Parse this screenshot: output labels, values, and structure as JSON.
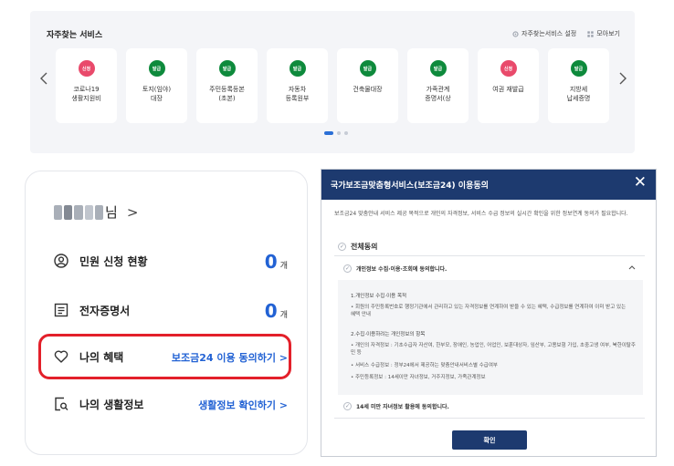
{
  "services": {
    "title": "자주찾는 서비스",
    "settings_label": "자주찾는서비스 설정",
    "view_all_label": "모아보기",
    "items": [
      {
        "badge": "신청",
        "badge_color": "#e94a6b",
        "name": "코로나19\n생활지원비"
      },
      {
        "badge": "발급",
        "badge_color": "#0e8a3c",
        "name": "토지(임야)\n대장"
      },
      {
        "badge": "발급",
        "badge_color": "#0e8a3c",
        "name": "주민등록등본\n(초본)"
      },
      {
        "badge": "발급",
        "badge_color": "#0e8a3c",
        "name": "자동차\n등록원부"
      },
      {
        "badge": "발급",
        "badge_color": "#0e8a3c",
        "name": "건축물대장"
      },
      {
        "badge": "발급",
        "badge_color": "#0e8a3c",
        "name": "가족관계\n증명서(상"
      },
      {
        "badge": "신청",
        "badge_color": "#e94a6b",
        "name": "여권 재발급"
      },
      {
        "badge": "발급",
        "badge_color": "#0e8a3c",
        "name": "지방세\n납세증명"
      }
    ]
  },
  "my": {
    "user_suffix": "님",
    "chevron": ">",
    "civil": {
      "label": "민원 신청 현황",
      "count": "0",
      "unit": "개"
    },
    "edoc": {
      "label": "전자증명서",
      "count": "0",
      "unit": "개"
    },
    "benefit": {
      "label": "나의 혜택",
      "link": "보조금24 이용 동의하기  >"
    },
    "life": {
      "label": "나의 생활정보",
      "link": "생활정보 확인하기  >"
    }
  },
  "modal": {
    "title": "국가보조금맞춤형서비스(보조금24) 이용동의",
    "close": "✕",
    "description": "보조금24 맞춤안내 서비스 제공 목적으로 개인의 자격정보, 서비스 수급 정보의 실시간 확인을 위한 정보연계 동의가 필요합니다.",
    "all_agree": "전체동의",
    "sub_agree": "개인정보 수집·이용·조회에 동의합니다.",
    "details": [
      "1.개인정보 수집·이용 목적",
      "• 회원의 주민등록번호로 행정기관에서 관리하고 있는 자격정보를 연계하여 받을 수 있는 혜택, 수급정보를 연계하여 이미 받고 있는",
      "  혜택 안내",
      "2.수집·이용하려는 개인정보의 항목",
      "• 개인의 자격정보 : 기초수급자 자산여, 한부모, 장애인, 농업인, 어업인, 보훈대상자, 임산부, 고용보험 가입, 초중고생 여부, 북한이탈주",
      "  민 등",
      "• 서비스 수급정보 : 정부24에서 제공하는 맞춤안내서비스별 수급여부",
      "• 주민등록정보 : 14세이만 자녀정보, 거주지정보, 가족관계정보"
    ],
    "agree14": "14세 미만 자녀정보 활용에 동의합니다.",
    "confirm": "확인"
  }
}
